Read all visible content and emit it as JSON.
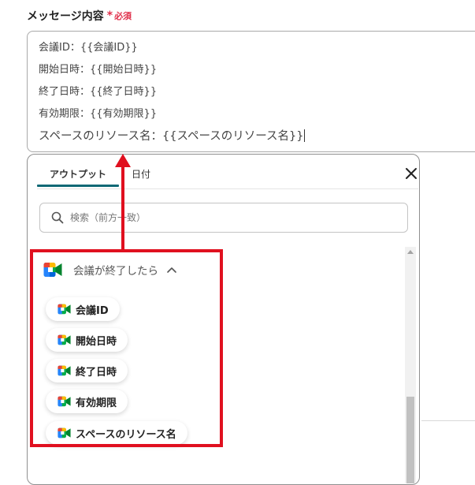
{
  "field": {
    "label": "メッセージ内容",
    "required_star": "*",
    "required_text": "必須"
  },
  "message": {
    "lines": [
      "会議ID：{{会議ID}}",
      "開始日時：{{開始日時}}",
      "終了日時：{{終了日時}}",
      "有効期限：{{有効期限}}",
      "スペースのリソース名：{{スペースのリソース名}}"
    ]
  },
  "panel": {
    "tabs": [
      {
        "label": "アウトプット",
        "active": true
      },
      {
        "label": "日付",
        "active": false
      }
    ],
    "search_placeholder": "検索（前方一致）",
    "group": {
      "title": "会議が終了したら",
      "expanded": true,
      "items": [
        "会議ID",
        "開始日時",
        "終了日時",
        "有効期限",
        "スペースのリソース名"
      ]
    }
  },
  "colors": {
    "tab_active_underline": "#0f6875",
    "required": "#e0304b",
    "highlight": "#e0101f"
  },
  "icons": {
    "close": "close-icon",
    "search": "search-icon",
    "chevron": "chevron-up-icon",
    "app": "google-meet-icon"
  }
}
